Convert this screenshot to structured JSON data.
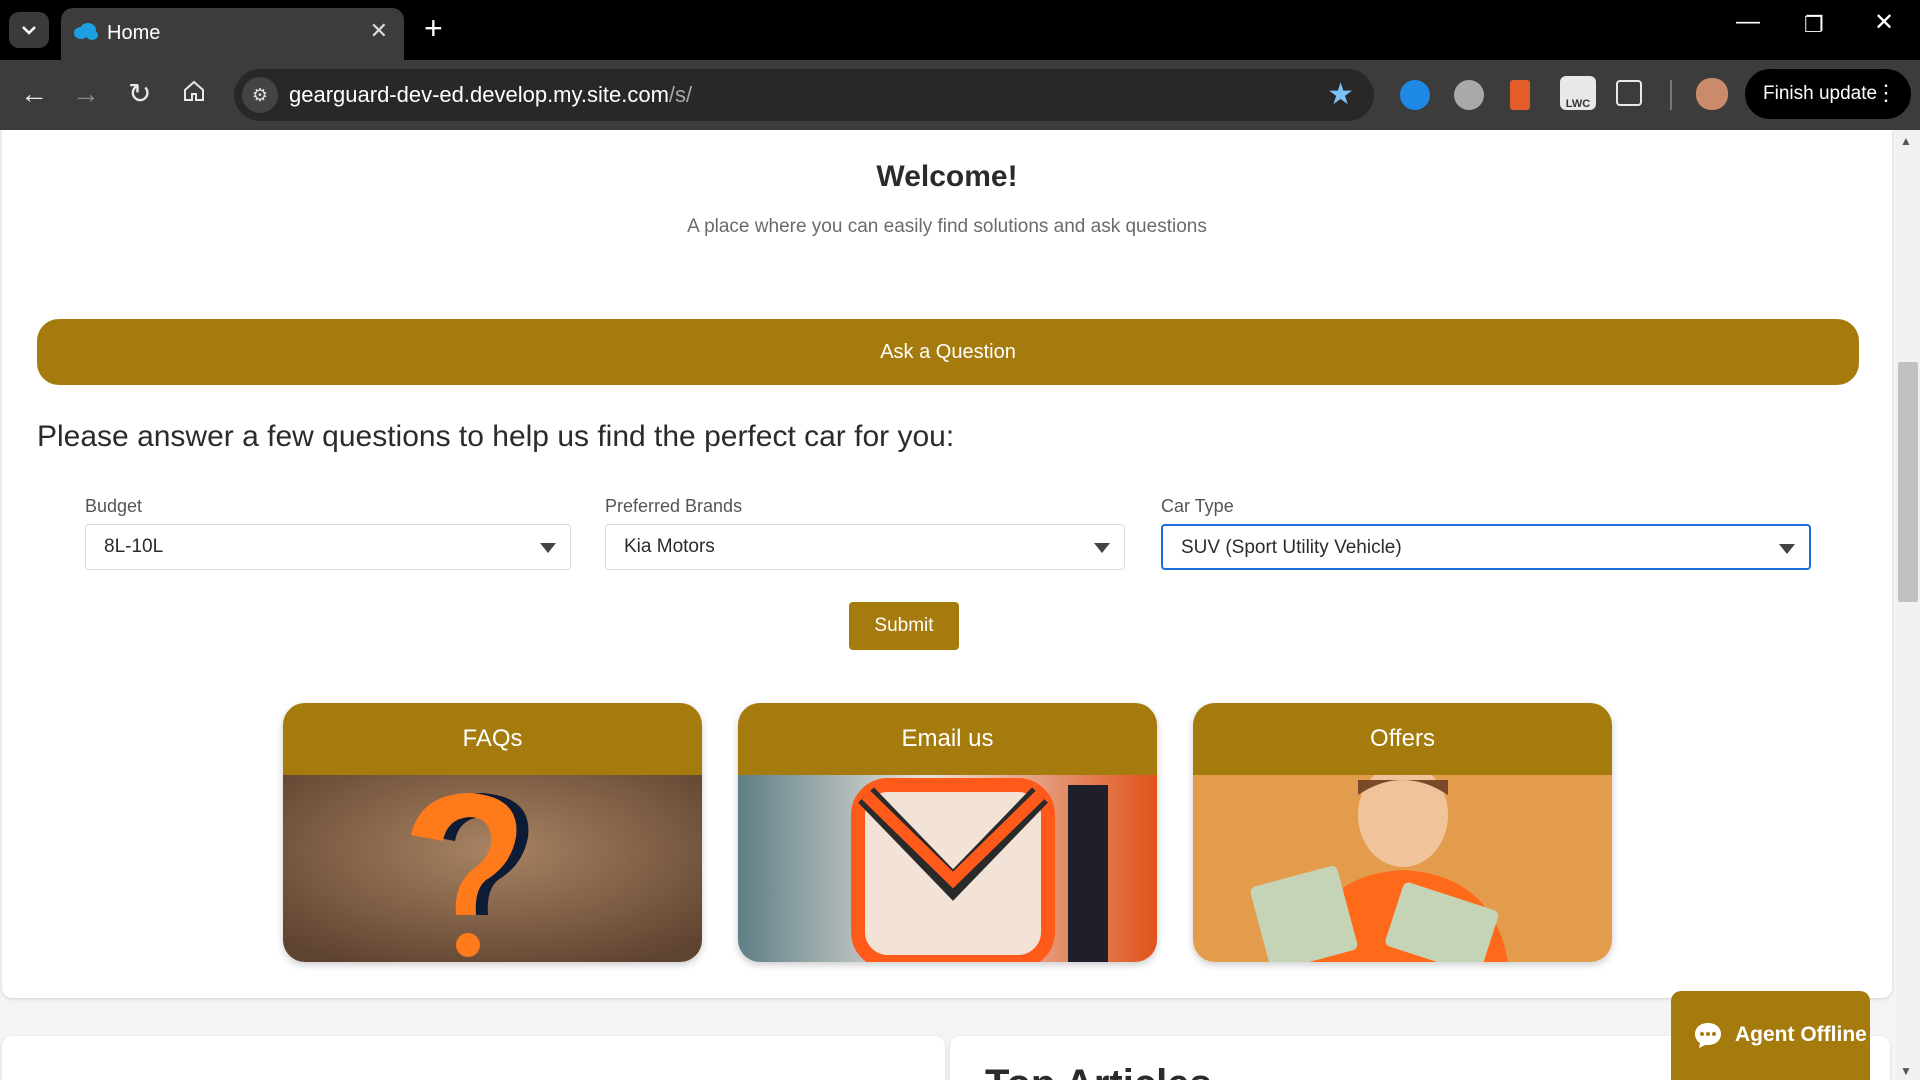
{
  "browser": {
    "tab_title": "Home",
    "url_host": "gearguard-dev-ed.develop.my.site.com",
    "url_path": "/s/",
    "finish_update": "Finish update",
    "ext_lwc": "LWC"
  },
  "page": {
    "welcome": "Welcome!",
    "subtitle": "A place where you can easily find solutions and ask questions",
    "ask_button": "Ask a Question",
    "prompt": "Please answer a few questions to help us find the perfect car for you:",
    "fields": {
      "budget": {
        "label": "Budget",
        "value": "8L-10L"
      },
      "brands": {
        "label": "Preferred Brands",
        "value": "Kia Motors"
      },
      "car_type": {
        "label": "Car Type",
        "value": "SUV (Sport Utility Vehicle)"
      }
    },
    "submit": "Submit",
    "tiles": {
      "faqs": "FAQs",
      "email": "Email us",
      "offers": "Offers"
    },
    "top_articles": "Top Articles"
  },
  "chat": {
    "label": "Agent Offline"
  },
  "colors": {
    "accent": "#a67b0d",
    "focus": "#1b6fd8"
  }
}
